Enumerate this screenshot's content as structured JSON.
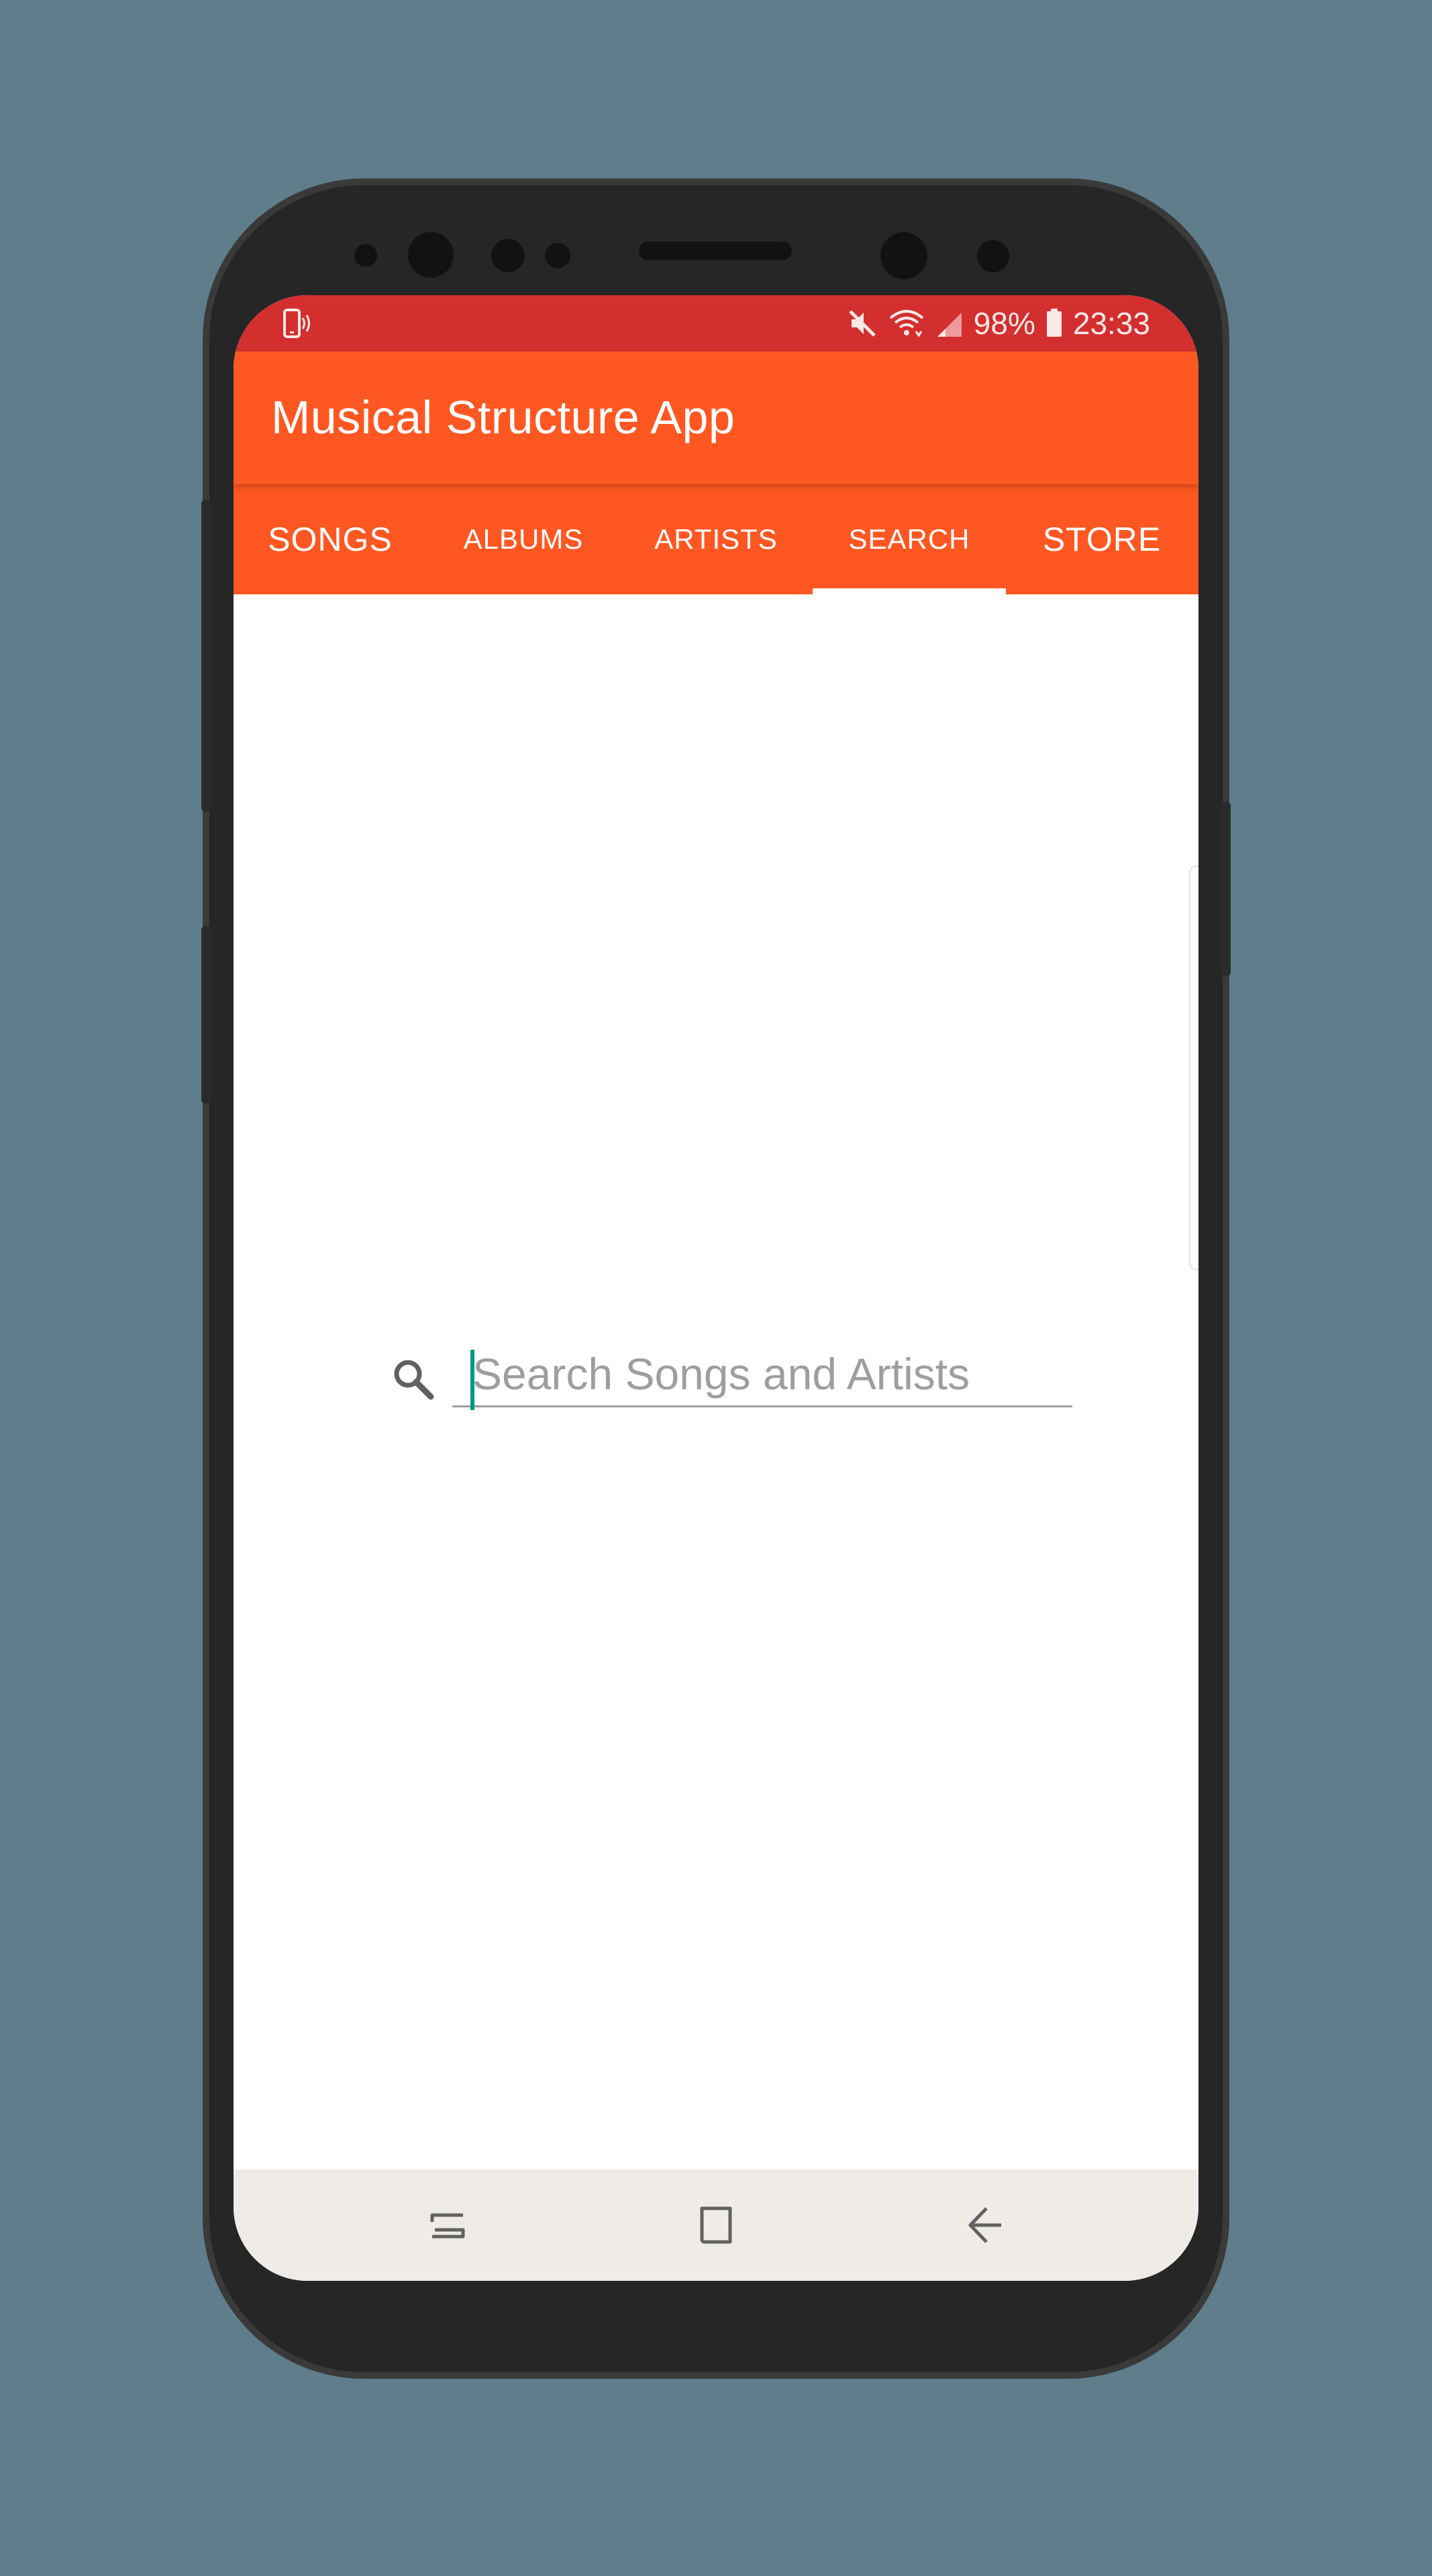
{
  "status_bar": {
    "battery": "98%",
    "time": "23:33",
    "icons": [
      "vibrate-phone-icon",
      "mute-icon",
      "wifi-icon",
      "signal-icon",
      "battery-icon"
    ]
  },
  "app_bar": {
    "title": "Musical Structure App"
  },
  "tabs": [
    {
      "label": "SONGS"
    },
    {
      "label": "ALBUMS"
    },
    {
      "label": "ARTISTS"
    },
    {
      "label": "SEARCH",
      "selected": true
    },
    {
      "label": "STORE"
    }
  ],
  "search": {
    "placeholder": "Search Songs and Artists",
    "value": "",
    "icon": "search-icon"
  },
  "nav_bar": {
    "buttons": [
      "recents-icon",
      "home-icon",
      "back-icon"
    ]
  },
  "colors": {
    "background": "#607d8b",
    "status_bar": "#d32f2f",
    "primary": "#ff5722",
    "accent": "#009688",
    "nav_bar": "#efebe7"
  }
}
